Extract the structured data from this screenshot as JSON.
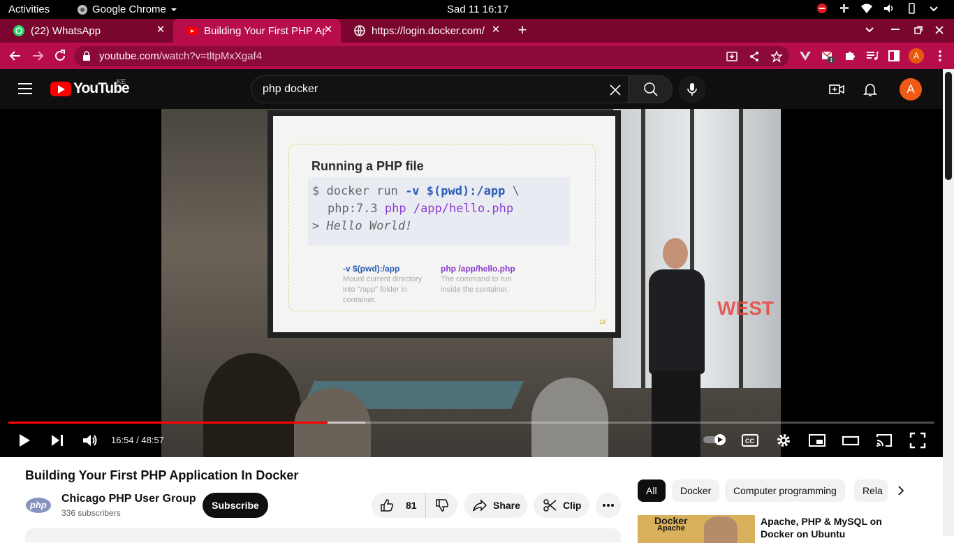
{
  "system_bar": {
    "activities": "Activities",
    "app_name": "Google Chrome",
    "clock": "Sad 11  16:17"
  },
  "tabs": [
    {
      "label": "(22) WhatsApp",
      "active": false
    },
    {
      "label": "Building Your First PHP Ap",
      "active": true
    },
    {
      "label": "https://login.docker.com/",
      "active": false
    }
  ],
  "toolbar": {
    "url_host": "youtube.com",
    "url_path": "/watch?v=tltpMxXgaf4",
    "profile_initial": "A",
    "mail_badge": "1"
  },
  "youtube": {
    "logo_text": "YouTube",
    "country_code": "KE",
    "search_query": "php docker",
    "avatar_initial": "A"
  },
  "player": {
    "current_time": "16:54",
    "duration": "48:57",
    "time_display": "16:54 / 48:57",
    "played_fraction": 0.345,
    "buffered_fraction": 0.385,
    "slide": {
      "title": "Running a PHP file",
      "code_line1_prompt": "$ docker run ",
      "code_line1_flag": "-v $(pwd):/app",
      "code_line1_tail": " \\",
      "code_line2_image": "php:7.3 ",
      "code_line2_cmd": "php /app/hello.php",
      "code_line3": "> Hello World!",
      "note1_head": "-v $(pwd):/app",
      "note1_body": "Mount current directory into \"/app\" folder in container.",
      "note2_head": "php /app/hello.php",
      "note2_body": "The command to run inside the container.",
      "page_num": "19"
    },
    "wall_sign": "WEST"
  },
  "video": {
    "title": "Building Your First PHP Application In Docker",
    "channel_name": "Chicago PHP User Group",
    "subscribers": "336 subscribers",
    "subscribe_label": "Subscribe",
    "likes": "81",
    "share_label": "Share",
    "clip_label": "Clip",
    "channel_logo_text": "php"
  },
  "chips": [
    "All",
    "Docker",
    "Computer programming",
    "Rela"
  ],
  "recommendation": {
    "thumb_line1": "Docker",
    "thumb_line2": "Apache",
    "title": "Apache, PHP & MySQL on Docker on Ubuntu"
  },
  "colors": {
    "chrome_frame": "#7a0630",
    "chrome_toolbar": "#b80d4b",
    "youtube_red": "#ff0000"
  }
}
